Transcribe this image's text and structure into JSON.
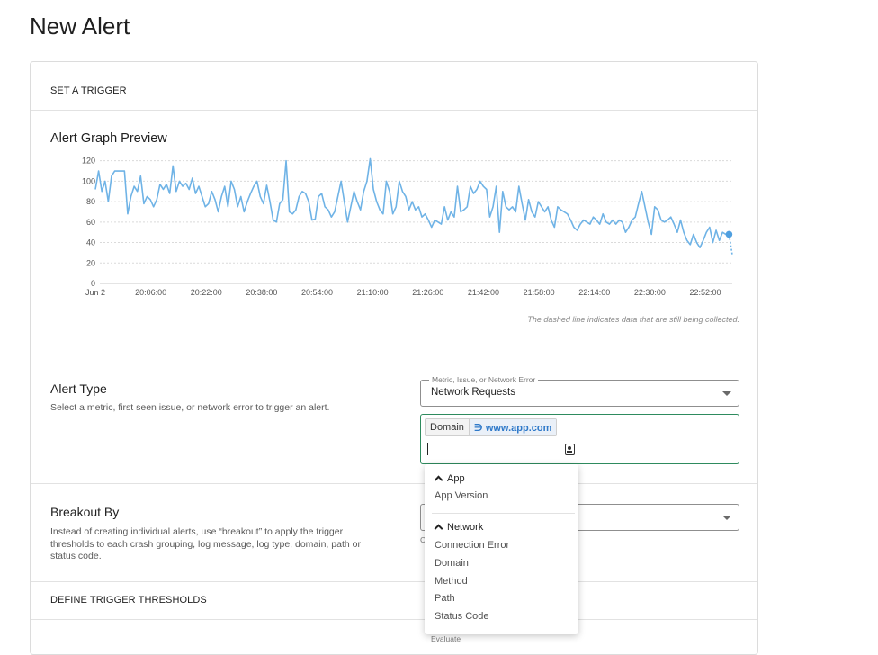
{
  "page": {
    "title": "New Alert"
  },
  "trigger": {
    "header": "SET A TRIGGER"
  },
  "graph": {
    "title": "Alert Graph Preview",
    "note": "The dashed line indicates data that are still being collected."
  },
  "chart_data": {
    "type": "line",
    "series": [
      {
        "values": [
          92,
          110,
          90,
          100,
          80,
          105,
          110,
          110,
          110,
          110,
          68,
          85,
          95,
          90,
          105,
          78,
          85,
          82,
          75,
          82,
          97,
          92,
          97,
          88,
          115,
          90,
          100,
          95,
          98,
          92,
          103,
          88,
          95,
          85,
          75,
          78,
          90,
          82,
          70,
          85,
          95,
          75,
          100,
          92,
          75,
          85,
          70,
          80,
          88,
          95,
          100,
          85,
          78,
          96,
          80,
          62,
          60,
          78,
          82,
          120,
          70,
          68,
          72,
          85,
          90,
          88,
          80,
          62,
          63,
          85,
          88,
          75,
          72,
          65,
          70,
          85,
          100,
          80,
          60,
          75,
          90,
          80,
          72,
          90,
          100,
          122,
          92,
          80,
          72,
          68,
          100,
          90,
          68,
          75,
          100,
          90,
          85,
          72,
          80,
          72,
          75,
          65,
          68,
          62,
          55,
          62,
          60,
          58,
          75,
          62,
          70,
          65,
          95,
          70,
          72,
          75,
          95,
          88,
          92,
          100,
          95,
          92,
          65,
          75,
          95,
          50,
          90,
          75,
          72,
          75,
          70,
          95,
          78,
          62,
          82,
          70,
          65,
          80,
          75,
          70,
          75,
          62,
          55,
          75,
          72,
          70,
          68,
          62,
          55,
          52,
          58,
          62,
          60,
          58,
          65,
          62,
          58,
          68,
          60,
          58,
          62,
          58,
          62,
          60,
          50,
          55,
          62,
          65,
          78,
          90,
          75,
          60,
          48,
          75,
          72,
          62,
          60,
          62,
          65,
          58,
          50,
          62,
          50,
          42,
          38,
          48,
          40,
          35,
          42,
          50,
          55,
          40,
          52,
          42,
          50,
          48
        ],
        "pending_values": [
          48,
          28
        ]
      }
    ],
    "x_tick_labels": [
      "Jun 2",
      "20:06:00",
      "20:22:00",
      "20:38:00",
      "20:54:00",
      "21:10:00",
      "21:26:00",
      "21:42:00",
      "21:58:00",
      "22:14:00",
      "22:30:00",
      "22:52:00"
    ],
    "y_ticks": [
      0,
      20,
      40,
      60,
      80,
      100,
      120
    ],
    "ylim": [
      0,
      125
    ],
    "grid": true,
    "color": "#6fb3e6"
  },
  "alert_type": {
    "title": "Alert Type",
    "description": "Select a metric, first seen issue, or network error to trigger an alert.",
    "select_label": "Metric, Issue, or Network Error",
    "select_value": "Network Requests",
    "filter_key": "Domain",
    "filter_value": "∋ www.app.com"
  },
  "dropdown": {
    "groups": [
      {
        "label": "App",
        "options": [
          "App Version"
        ]
      },
      {
        "label": "Network",
        "options": [
          "Connection Error",
          "Domain",
          "Method",
          "Path",
          "Status Code"
        ]
      }
    ]
  },
  "breakout": {
    "title": "Breakout By",
    "description": "Instead of creating individual alerts, use “breakout” to apply the trigger thresholds to each crash grouping, log message, log type, domain, path or status code.",
    "helper": "C"
  },
  "thresholds": {
    "header": "DEFINE TRIGGER THRESHOLDS",
    "partial_label": "Evaluate"
  }
}
